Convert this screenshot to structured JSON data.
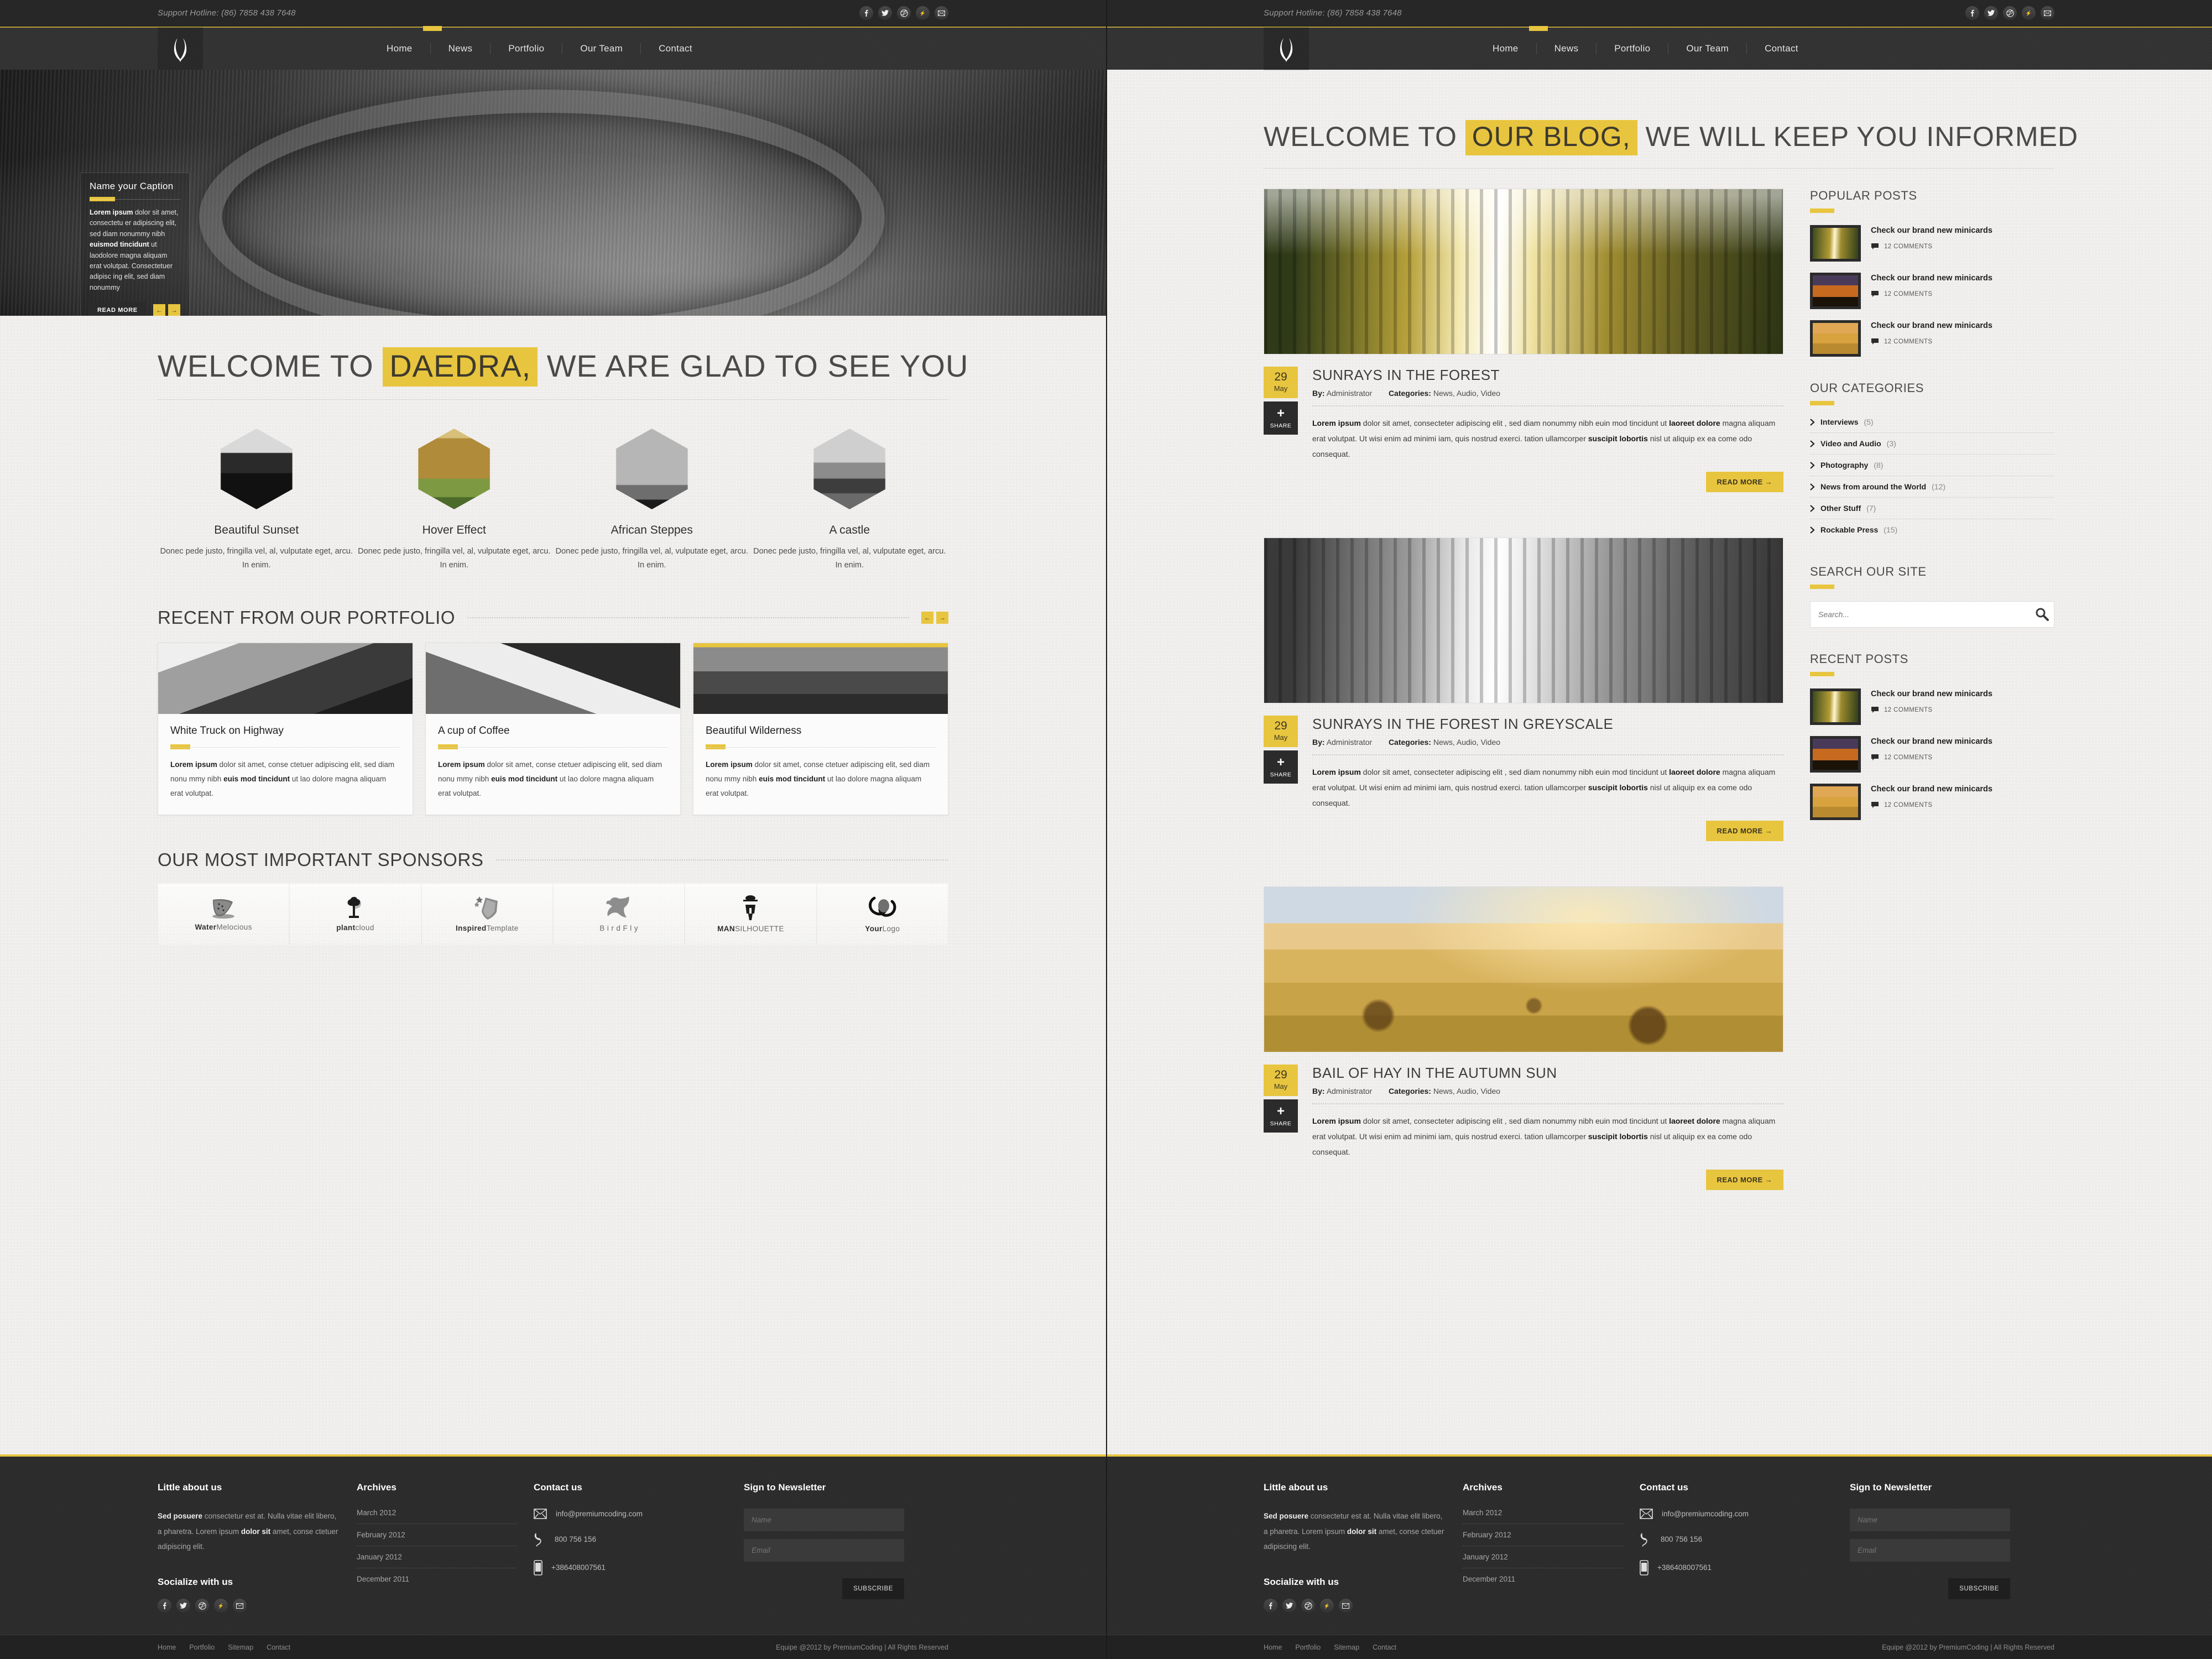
{
  "topbar": {
    "hotline": "Support Hotline: (86) 7858 438 7648",
    "social": [
      "facebook-icon",
      "twitter-icon",
      "dribbble-icon",
      "flickr-icon",
      "mail-icon"
    ]
  },
  "nav": {
    "logo": "laurel-wreath-logo",
    "items": [
      "Home",
      "News",
      "Portfolio",
      "Our Team",
      "Contact"
    ],
    "active": "Home"
  },
  "hero": {
    "caption_title": "Name your Caption",
    "caption_lead": "Lorem ipsum",
    "caption_text_1": " dolor sit amet, consectetu er adipiscing elit, sed diam nonummy nibh ",
    "caption_bold_2": "euismod tincidunt",
    "caption_text_2": " ut laodolore magna aliquam erat volutpat. Consectetuer adipisc ing elit, sed diam nonummy",
    "read_more": "READ MORE",
    "prev": "←",
    "next": "→"
  },
  "home": {
    "welcome_pre": "WELCOME TO",
    "welcome_hl": "DAEDRA,",
    "welcome_post": "WE ARE GLAD TO SEE YOU",
    "features": [
      {
        "title": "Beautiful Sunset",
        "text": "Donec pede justo, fringilla vel, al, vulputate eget, arcu. In enim."
      },
      {
        "title": "Hover Effect",
        "text": "Donec pede justo, fringilla vel, al, vulputate eget, arcu. In enim."
      },
      {
        "title": "African Steppes",
        "text": "Donec pede justo, fringilla vel, al, vulputate eget, arcu. In enim."
      },
      {
        "title": "A castle",
        "text": "Donec pede justo, fringilla vel, al, vulputate eget, arcu. In enim."
      }
    ],
    "portfolio_heading": "RECENT FROM OUR  PORTFOLIO",
    "portfolio": [
      {
        "title": "White Truck on Highway",
        "lead": "Lorem ipsum",
        "text_a": " dolor sit amet, conse ctetuer adipiscing elit, sed diam nonu mmy nibh ",
        "bold_b": "euis mod tincidunt",
        "text_b": " ut lao dolore magna aliquam erat volutpat."
      },
      {
        "title": "A cup of Coffee",
        "lead": "Lorem ipsum",
        "text_a": " dolor sit amet, conse ctetuer adipiscing elit, sed diam nonu mmy nibh ",
        "bold_b": "euis mod tincidunt",
        "text_b": " ut lao dolore magna aliquam erat volutpat."
      },
      {
        "title": "Beautiful Wilderness",
        "lead": "Lorem ipsum",
        "text_a": " dolor sit amet, conse ctetuer adipiscing elit, sed diam nonu mmy nibh ",
        "bold_b": "euis mod tincidunt",
        "text_b": " ut lao dolore magna aliquam erat volutpat."
      }
    ],
    "sponsors_heading": "OUR MOST IMPORTANT SPONSORS",
    "sponsors": [
      {
        "name_bold": "Water",
        "name_rest": "Melocious",
        "icon": "watermelon-icon"
      },
      {
        "name_bold": "plant",
        "name_rest": "cloud",
        "icon": "tree-icon"
      },
      {
        "name_bold": "Inspired",
        "name_rest": "Template",
        "icon": "shield-stars-icon"
      },
      {
        "name_bold": "",
        "name_rest": "B i r d F l y",
        "icon": "bird-icon"
      },
      {
        "name_bold": "MAN",
        "name_rest": "SILHOUETTE",
        "icon": "man-silhouette-icon"
      },
      {
        "name_bold": "Your",
        "name_rest": "Logo",
        "icon": "swirl-icon"
      }
    ]
  },
  "blog": {
    "welcome_pre": "WELCOME TO",
    "welcome_hl": "OUR BLOG,",
    "welcome_post": "WE WILL KEEP YOU INFORMED",
    "posts": [
      {
        "day": "29",
        "month": "May",
        "share": "SHARE",
        "plus": "+",
        "title": "SUNRAYS IN THE FOREST",
        "by_label": "By:",
        "by_value": "Administrator",
        "cat_label": "Categories:",
        "cat_value": "News, Audio, Video",
        "lead": "Lorem ipsum",
        "text_a": " dolor sit amet, consecteter adipiscing elit , sed diam nonummy nibh euin mod tincidunt ut ",
        "bold_b": "laoreet dolore",
        "text_b": " magna aliquam erat volutpat. Ut wisi enim ad minimi iam, quis nostrud exerci. tation ullamcorper ",
        "bold_c": "suscipit lobortis",
        "text_c": " nisl ut aliquip ex ea come odo consequat.",
        "read_more": "READ MORE →",
        "image": "sunrays-forest-color"
      },
      {
        "day": "29",
        "month": "May",
        "share": "SHARE",
        "plus": "+",
        "title": "SUNRAYS IN THE FOREST IN GREYSCALE",
        "by_label": "By:",
        "by_value": "Administrator",
        "cat_label": "Categories:",
        "cat_value": "News, Audio, Video",
        "lead": "Lorem ipsum",
        "text_a": " dolor sit amet, consecteter adipiscing elit , sed diam nonummy nibh euin mod tincidunt ut ",
        "bold_b": "laoreet dolore",
        "text_b": " magna aliquam erat volutpat. Ut wisi enim ad minimi iam, quis nostrud exerci. tation ullamcorper ",
        "bold_c": "suscipit lobortis",
        "text_c": " nisl ut aliquip ex ea come odo consequat.",
        "read_more": "READ MORE →",
        "image": "sunrays-forest-greyscale"
      },
      {
        "day": "29",
        "month": "May",
        "share": "SHARE",
        "plus": "+",
        "title": "BAIL OF HAY IN THE AUTUMN SUN",
        "by_label": "By:",
        "by_value": "Administrator",
        "cat_label": "Categories:",
        "cat_value": "News, Audio, Video",
        "lead": "Lorem ipsum",
        "text_a": " dolor sit amet, consecteter adipiscing elit , sed diam nonummy nibh euin mod tincidunt ut ",
        "bold_b": "laoreet dolore",
        "text_b": " magna aliquam erat volutpat. Ut wisi enim ad minimi iam, quis nostrud exerci. tation ullamcorper ",
        "bold_c": "suscipit lobortis",
        "text_c": " nisl ut aliquip ex ea come odo consequat.",
        "read_more": "READ MORE →",
        "image": "bail-of-hay-autumn"
      }
    ],
    "sidebar": {
      "popular_title": "POPULAR POSTS",
      "popular": [
        {
          "title": "Check our brand new minicards",
          "comments": "12 COMMENTS",
          "thumb": "forest-sunrays-thumb"
        },
        {
          "title": "Check our brand new minicards",
          "comments": "12 COMMENTS",
          "thumb": "sunset-palms-thumb"
        },
        {
          "title": "Check our brand new minicards",
          "comments": "12 COMMENTS",
          "thumb": "hay-field-thumb"
        }
      ],
      "categories_title": "OUR CATEGORIES",
      "categories": [
        {
          "name": "Interviews",
          "count": "(5)"
        },
        {
          "name": "Video and Audio",
          "count": "(3)"
        },
        {
          "name": "Photography",
          "count": "(8)"
        },
        {
          "name": "News from around the World",
          "count": "(12)"
        },
        {
          "name": "Other Stuff",
          "count": "(7)"
        },
        {
          "name": "Rockable Press",
          "count": "(15)"
        }
      ],
      "search_title": "SEARCH OUR SITE",
      "search_placeholder": "Search...",
      "search_value": "",
      "recent_title": "RECENT POSTS",
      "recent": [
        {
          "title": "Check our brand new minicards",
          "comments": "12 COMMENTS",
          "thumb": "forest-sunrays-thumb"
        },
        {
          "title": "Check our brand new minicards",
          "comments": "12 COMMENTS",
          "thumb": "sunset-palms-thumb"
        },
        {
          "title": "Check our brand new minicards",
          "comments": "12 COMMENTS",
          "thumb": "hay-field-thumb"
        }
      ]
    }
  },
  "footer": {
    "about_title": "Little about us",
    "about_bold": "Sed posuere",
    "about_text_a": " consectetur  est at. Nulla vitae elit libero, a pharetra. Lorem ipsum ",
    "about_bold_b": "dolor sit",
    "about_text_b": " amet, conse ctetuer adipiscing elit.",
    "social_title": "Socialize with us",
    "archives_title": "Archives",
    "archives": [
      "March 2012",
      "February 2012",
      "January 2012",
      "December 2011"
    ],
    "contact_title": "Contact us",
    "contact_email": "info@premiumcoding.com",
    "contact_phone": "800 756 156",
    "contact_mobile": "+386408007561",
    "newsletter_title": "Sign to Newsletter",
    "name_placeholder": "Name",
    "email_placeholder": "Email",
    "subscribe": "SUBSCRIBE",
    "bottom_links": [
      "Home",
      "Portfolio",
      "Sitemap",
      "Contact"
    ],
    "copyright": "Equipe @2012 by PremiumCoding | All Rights Reserved"
  },
  "colors": {
    "accent": "#e8c53f",
    "dark": "#2b2b2b",
    "paper": "#f0efed"
  }
}
